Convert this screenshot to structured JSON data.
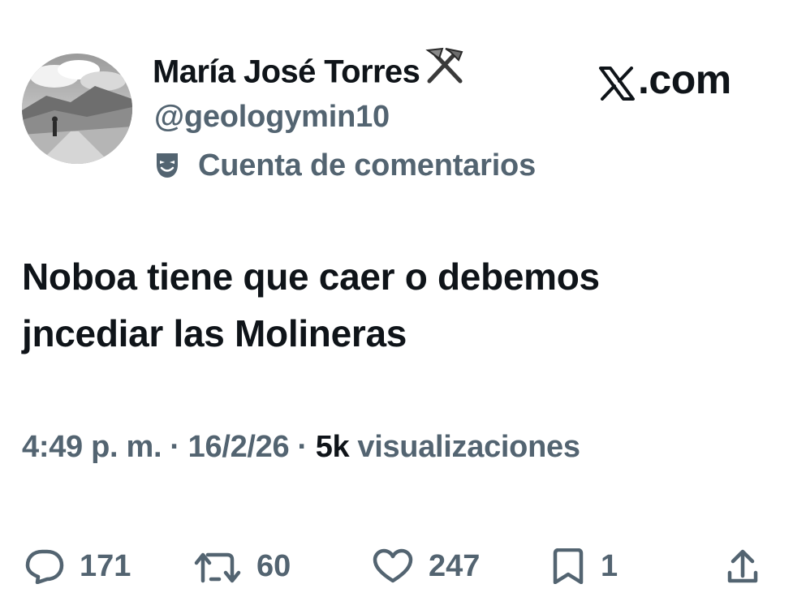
{
  "author": {
    "display_name": "María José Torres",
    "name_emoji": "pick-and-hammer-emoji",
    "handle": "@geologymin10",
    "avatar": "landscape-photo-avatar"
  },
  "commentary_label": "Cuenta de comentarios",
  "site": {
    "logo": "x-logo",
    "label": ".com"
  },
  "tweet": {
    "text_line1": "Noboa tiene que caer o debemos",
    "text_line2": "jncediar las Molineras"
  },
  "meta": {
    "time": "4:49 p. m.",
    "separator": "·",
    "date": "16/2/26",
    "views_count": "5k",
    "views_label": "visualizaciones"
  },
  "actions": {
    "replies": "171",
    "reposts": "60",
    "likes": "247",
    "bookmarks": "1"
  },
  "colors": {
    "text_primary": "#0f1419",
    "text_secondary": "#536471",
    "background": "#ffffff"
  }
}
